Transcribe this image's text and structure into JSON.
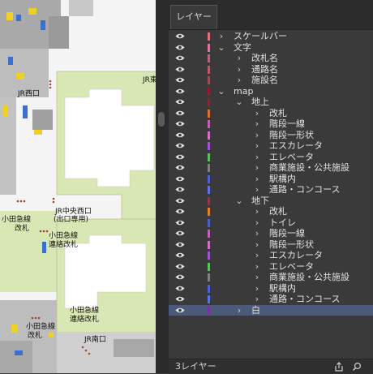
{
  "panel": {
    "tab_label": "レイヤー",
    "layer_count": "3レイヤー"
  },
  "map_labels": {
    "jr_west": "JR西口",
    "jr_partial": "JR東",
    "jr_central_west_line1": "JR中央西口",
    "jr_central_west_line2": "(出口専用)",
    "odakyu_gate_line1": "小田急線",
    "odakyu_gate_line2": "改札",
    "odakyu_connect_line1": "小田急線",
    "odakyu_connect_line2": "連絡改札",
    "odakyu_connect2_line1": "小田急線",
    "odakyu_connect2_line2": "連絡改札",
    "odakyu_gate2_line1": "小田急線",
    "odakyu_gate2_line2": "改札",
    "jr_south": "JR南口"
  },
  "colors": {
    "panel_bg": "#3a3a3a",
    "selected_row": "#4a5a78",
    "map_green": "#d9e7b4"
  },
  "layers": [
    {
      "name": "スケールバー",
      "depth": 0,
      "expanded": false,
      "color": "#e0707a"
    },
    {
      "name": "文字",
      "depth": 0,
      "expanded": true,
      "color": "#d87a9e"
    },
    {
      "name": "改札名",
      "depth": 1,
      "expanded": false,
      "color": "#b06a7a"
    },
    {
      "name": "通路名",
      "depth": 1,
      "expanded": false,
      "color": "#b85a6a"
    },
    {
      "name": "施設名",
      "depth": 1,
      "expanded": false,
      "color": "#9a4a5a"
    },
    {
      "name": "map",
      "depth": 0,
      "expanded": true,
      "color": "#8a2030"
    },
    {
      "name": "地上",
      "depth": 1,
      "expanded": true,
      "color": "#7a2a3a"
    },
    {
      "name": "改札",
      "depth": 2,
      "expanded": false,
      "color": "#e07030"
    },
    {
      "name": "階段一線",
      "depth": 2,
      "expanded": false,
      "color": "#c060b0"
    },
    {
      "name": "階段一形状",
      "depth": 2,
      "expanded": false,
      "color": "#d070c8"
    },
    {
      "name": "エスカレータ",
      "depth": 2,
      "expanded": false,
      "color": "#a050d0"
    },
    {
      "name": "エレベータ",
      "depth": 2,
      "expanded": false,
      "color": "#60c060"
    },
    {
      "name": "商業施設・公共施設",
      "depth": 2,
      "expanded": false,
      "color": "#808080"
    },
    {
      "name": "駅構内",
      "depth": 2,
      "expanded": false,
      "color": "#5060d0"
    },
    {
      "name": "通路・コンコース",
      "depth": 2,
      "expanded": false,
      "color": "#6070e0"
    },
    {
      "name": "地下",
      "depth": 1,
      "expanded": true,
      "color": "#8a3a4a"
    },
    {
      "name": "改札",
      "depth": 2,
      "expanded": false,
      "color": "#e08030"
    },
    {
      "name": "トイレ",
      "depth": 2,
      "expanded": false,
      "color": "#5060c0"
    },
    {
      "name": "階段一線",
      "depth": 2,
      "expanded": false,
      "color": "#c060b0"
    },
    {
      "name": "階段一形状",
      "depth": 2,
      "expanded": false,
      "color": "#d070c8"
    },
    {
      "name": "エスカレータ",
      "depth": 2,
      "expanded": false,
      "color": "#a050d0"
    },
    {
      "name": "エレベータ",
      "depth": 2,
      "expanded": false,
      "color": "#60c060"
    },
    {
      "name": "商業施設・公共施設",
      "depth": 2,
      "expanded": false,
      "color": "#808080"
    },
    {
      "name": "駅構内",
      "depth": 2,
      "expanded": false,
      "color": "#5060d0"
    },
    {
      "name": "通路・コンコース",
      "depth": 2,
      "expanded": false,
      "color": "#6070e0"
    },
    {
      "name": "白",
      "depth": 1,
      "expanded": false,
      "selected": true,
      "color": "#7a30a0"
    }
  ]
}
